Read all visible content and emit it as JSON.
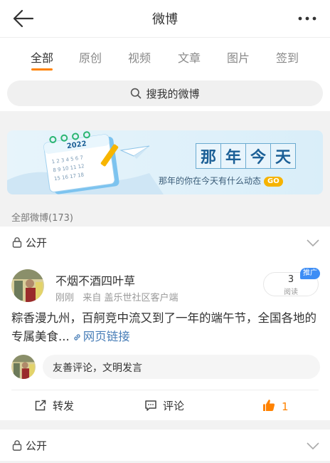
{
  "header": {
    "title": "微博"
  },
  "tabs": [
    "全部",
    "原创",
    "视频",
    "文章",
    "图片",
    "签到"
  ],
  "search": {
    "placeholder": "搜我的微博"
  },
  "banner": {
    "title_chars": [
      "那",
      "年",
      "今",
      "天"
    ],
    "subtitle": "那年的你在今天有什么动态",
    "go_label": "GO",
    "calendar_year": "2022"
  },
  "feed": {
    "count_label": "全部微博(173)"
  },
  "visibility": {
    "label": "公开"
  },
  "post": {
    "author": "不烟不酒四叶草",
    "time": "刚刚",
    "source": "来自 盖乐世社区客户端",
    "read_count": "3",
    "read_label": "阅读",
    "promo_badge": "推广",
    "text": "粽香漫九州，百舸竞中流又到了一年的端午节，全国各地的专属美食...",
    "link_label": "网页链接",
    "comment_placeholder": "友善评论，文明发言",
    "actions": {
      "repost": "转发",
      "comment": "评论",
      "like_count": "1"
    }
  },
  "colors": {
    "accent": "#ff8200",
    "link": "#4a7fb8",
    "badge": "#3d8df5",
    "like": "#ff8200",
    "background": "#f2f2f2"
  }
}
